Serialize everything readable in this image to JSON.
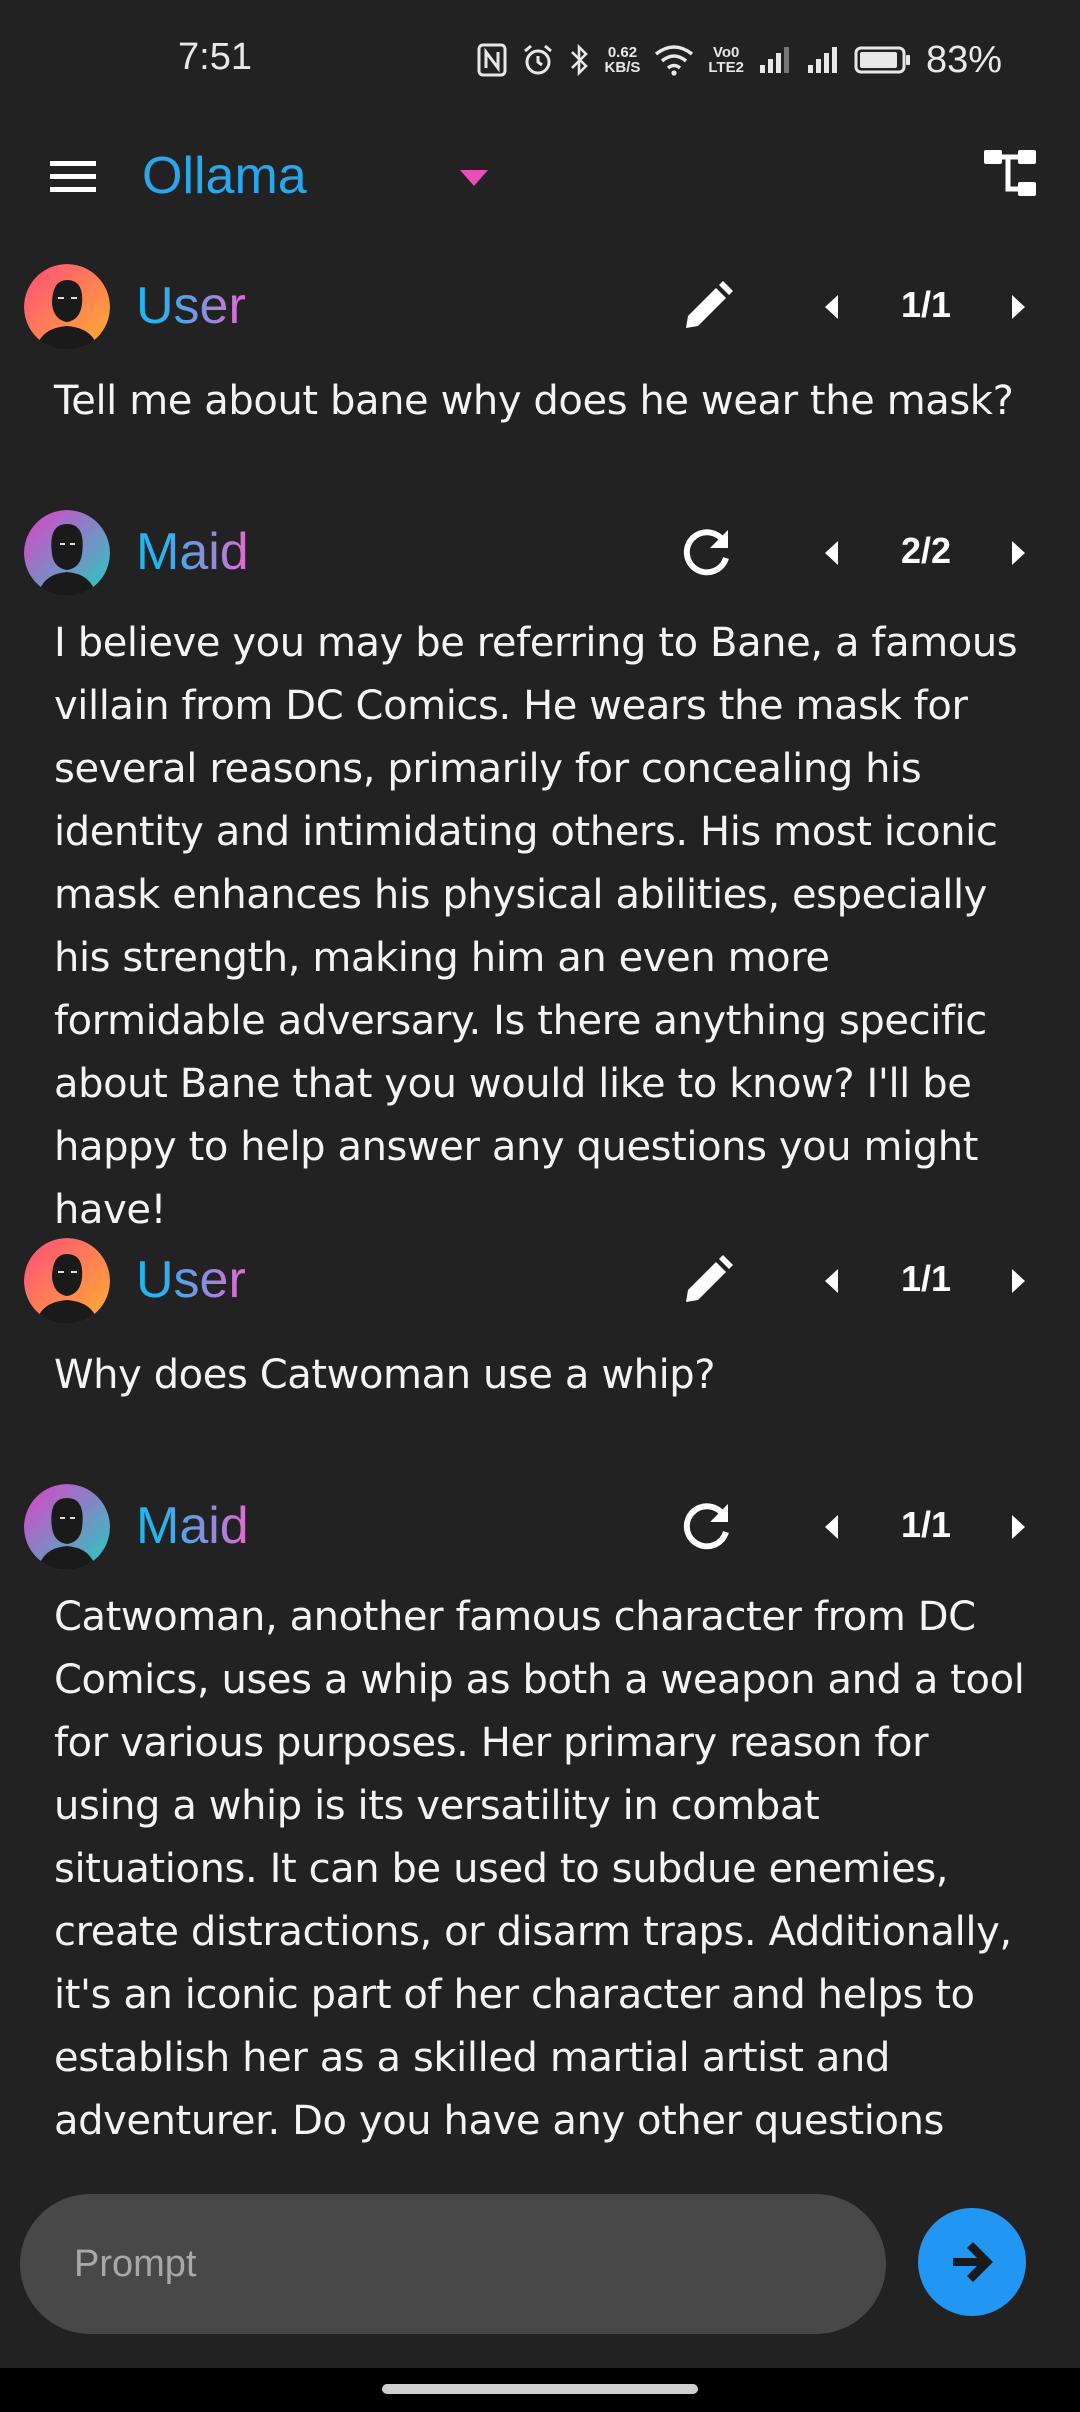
{
  "status_bar": {
    "time": "7:51",
    "net_speed_value": "0.62",
    "net_speed_unit": "KB/S",
    "volte_top": "Vo0",
    "volte_bottom": "LTE2",
    "battery_percent": "83%"
  },
  "app_bar": {
    "model_name": "Ollama"
  },
  "messages": [
    {
      "role": "User",
      "page": "1/1",
      "text": "Tell me about bane why does he wear the mask?"
    },
    {
      "role": "Maid",
      "page": "2/2",
      "text": "I believe you may be referring to Bane, a famous villain from DC Comics. He wears the mask for several reasons, primarily for concealing his identity and intimidating others. His most iconic mask enhances his physical abilities, especially his strength, making him an even more formidable adversary. Is there anything specific about Bane that you would like to know? I'll be happy to help answer any questions you might have!"
    },
    {
      "role": "User",
      "page": "1/1",
      "text": "Why does Catwoman use a whip?"
    },
    {
      "role": "Maid",
      "page": "1/1",
      "text": "Catwoman, another famous character from DC Comics, uses a whip as both a weapon and a tool for various purposes. Her primary reason for using a whip is its versatility in combat situations. It can be used to subdue enemies, create distractions, or disarm traps. Additionally, it's an iconic part of her character and helps to establish her as a skilled martial artist and adventurer. Do you have any other questions about Catwoman or"
    }
  ],
  "input": {
    "placeholder": "Prompt"
  },
  "colors": {
    "accent_blue": "#2196f3",
    "title_blue": "#29a7ec",
    "role_gradient_start": "#22b5f0",
    "role_gradient_end": "#e46bd0",
    "dropdown_pink": "#e84fb8",
    "background": "#222222"
  }
}
